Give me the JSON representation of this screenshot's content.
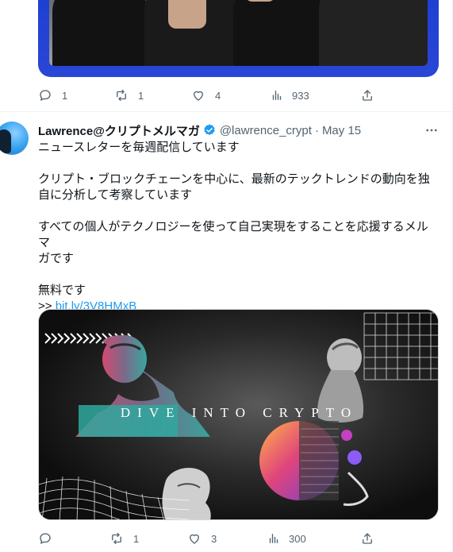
{
  "prev_tweet": {
    "actions": {
      "replies": "1",
      "retweets": "1",
      "likes": "4",
      "views": "933"
    }
  },
  "tweet": {
    "display_name": "Lawrence@クリプトメルマガ",
    "handle": "@lawrence_crypt",
    "separator": "·",
    "date": "May 15",
    "text_lines": [
      "ニュースレターを毎週配信しています",
      "クリプト・ブロックチェーンを中心に、最新のテックトレンドの動向を独",
      "自に分析して考察しています",
      "すべての個人がテクノロジーを使って自己実現をすることを応援するメルマ",
      "ガです",
      "無料です"
    ],
    "link_prefix": ">> ",
    "link_text": "bit.ly/3V8HMxB",
    "media_text": "DIVE INTO CRYPTO",
    "actions": {
      "replies": "",
      "retweets": "1",
      "likes": "3",
      "views": "300"
    }
  },
  "colors": {
    "accent": "#1d9bf0",
    "muted": "#536471",
    "text": "#0f1419"
  }
}
